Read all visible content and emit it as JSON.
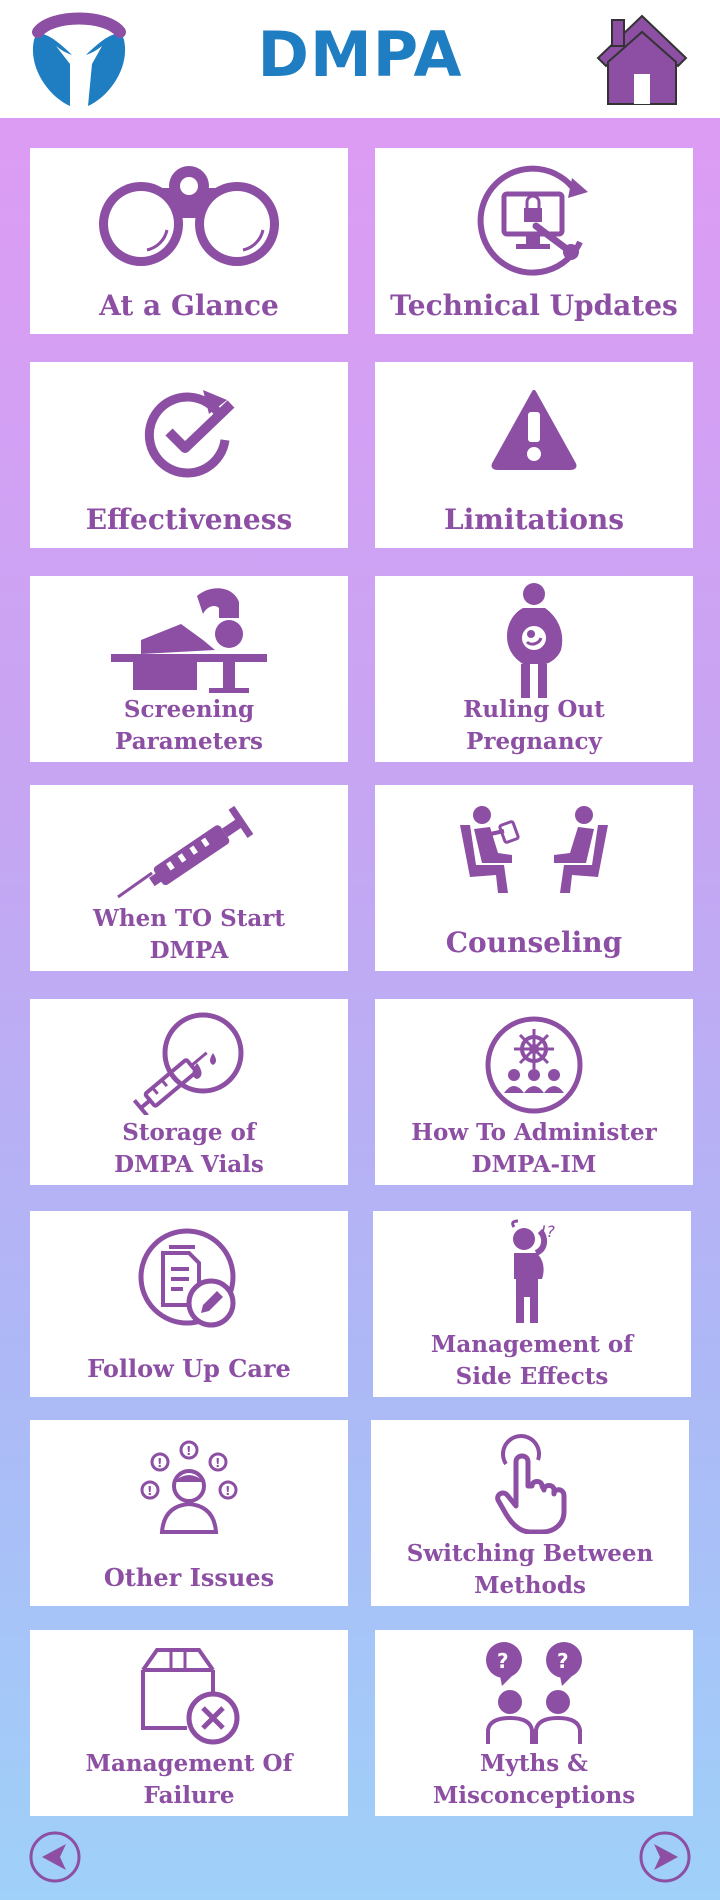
{
  "header": {
    "title": "DMPA",
    "logo_icon": "person-figure-logo",
    "home_icon": "home-icon"
  },
  "tiles": [
    {
      "label": "At a Glance",
      "icon": "binoculars-icon"
    },
    {
      "label": "Technical Updates",
      "icon": "monitor-wrench-icon"
    },
    {
      "label": "Effectiveness",
      "icon": "check-refresh-icon"
    },
    {
      "label": "Limitations",
      "icon": "warning-icon"
    },
    {
      "line1": "Screening",
      "line2": "Parameters",
      "icon": "examination-table-icon"
    },
    {
      "line1": "Ruling Out",
      "line2": "Pregnancy",
      "icon": "pregnant-woman-icon"
    },
    {
      "line1": "When TO Start",
      "line2": "DMPA",
      "icon": "syringe-icon"
    },
    {
      "label": "Counseling",
      "icon": "two-chairs-icon"
    },
    {
      "line1": "Storage of",
      "line2": "DMPA Vials",
      "icon": "syringe-drops-icon"
    },
    {
      "line1": "How To Administer",
      "line2": "DMPA-IM",
      "icon": "group-steering-icon"
    },
    {
      "label": "Follow Up Care",
      "icon": "document-edit-icon"
    },
    {
      "line1": "Management of",
      "line2": "Side Effects",
      "icon": "confused-person-icon"
    },
    {
      "label": "Other Issues",
      "icon": "person-alerts-icon"
    },
    {
      "line1": "Switching Between",
      "line2": "Methods",
      "icon": "pointing-hand-icon"
    },
    {
      "line1": "Management Of",
      "line2": "Failure",
      "icon": "box-cancel-icon"
    },
    {
      "line1": "Myths &",
      "line2": "Misconceptions",
      "icon": "people-questions-icon"
    }
  ],
  "footer": {
    "prev_icon": "arrow-left-circle-icon",
    "next_icon": "arrow-right-circle-icon"
  },
  "colors": {
    "title": "#1f7dc1",
    "icon_purple": "#8c4fa3",
    "gradient_top": "#dd9cf4",
    "gradient_bottom": "#9fd1f9"
  }
}
